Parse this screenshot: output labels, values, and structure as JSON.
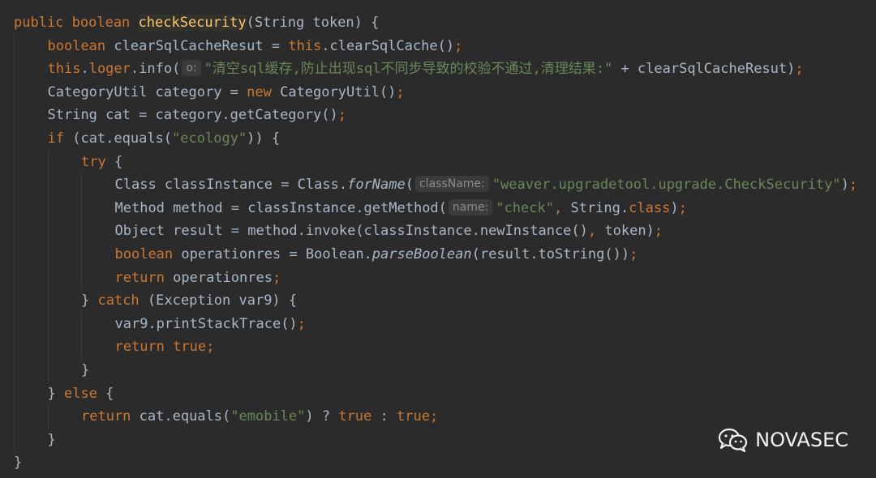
{
  "code": {
    "l1": {
      "t1": "public boolean ",
      "t2": "checkSecurity",
      "t3": "(String token) {"
    },
    "l2": {
      "t1": "boolean ",
      "t2": "clearSqlCacheResut = ",
      "t3": "this",
      "t4": ".clearSqlCache()",
      "t5": ";"
    },
    "l3": {
      "t1": "this",
      "t2": ".",
      "t3": "loger",
      "t4": ".info(",
      "hint": "o:",
      "t5": "\"清空sql缓存,防止出现sql不同步导致的校验不通过,清理结果:\"",
      "t6": " + clearSqlCacheResut)",
      "t7": ";"
    },
    "l4": {
      "t1": "CategoryUtil category = ",
      "t2": "new ",
      "t3": "CategoryUtil()",
      "t4": ";"
    },
    "l5": {
      "t1": "String cat = category.getCategory()",
      "t2": ";"
    },
    "l6": {
      "t1": "if ",
      "t2": "(cat.equals(",
      "t3": "\"ecology\"",
      "t4": ")) {"
    },
    "l7": {
      "t1": "try ",
      "t2": "{"
    },
    "l8": {
      "t1": "Class classInstance = Class.",
      "t2": "forName",
      "t3": "(",
      "hint": "className:",
      "t4": "\"weaver.upgradetool.upgrade.CheckSecurity\"",
      "t5": ")",
      "t6": ";"
    },
    "l9": {
      "t1": "Method method = classInstance.getMethod(",
      "hint": "name:",
      "t2": "\"check\"",
      "t3": ", ",
      "t4": "String.",
      "t5": "class",
      "t6": ")",
      "t7": ";"
    },
    "l10": {
      "t1": "Object result = method.invoke(classInstance.newInstance()",
      "t2": ", ",
      "t3": "token)",
      "t4": ";"
    },
    "l11": {
      "t1": "boolean ",
      "t2": "operationres = Boolean.",
      "t3": "parseBoolean",
      "t4": "(result.toString())",
      "t5": ";"
    },
    "l12": {
      "t1": "return ",
      "t2": "operationres",
      "t3": ";"
    },
    "l13": {
      "t1": "} ",
      "t2": "catch ",
      "t3": "(Exception var9) {"
    },
    "l14": {
      "t1": "var9.printStackTrace()",
      "t2": ";"
    },
    "l15": {
      "t1": "return ",
      "t2": "true",
      "t3": ";"
    },
    "l16": {
      "t1": "}"
    },
    "l17": {
      "t1": "} ",
      "t2": "else ",
      "t3": "{"
    },
    "l18": {
      "t1": "return ",
      "t2": "cat.equals(",
      "t3": "\"emobile\"",
      "t4": ") ? ",
      "t5": "true ",
      "t6": ": ",
      "t7": "true",
      "t8": ";"
    },
    "l19": {
      "t1": "}"
    },
    "l20": {
      "t1": "}"
    }
  },
  "watermark": {
    "text": "NOVASEC",
    "icon": "wechat-icon"
  },
  "colors": {
    "background": "#2b2b2b",
    "keyword": "#cc7832",
    "method_decl": "#ffc66d",
    "string": "#6a8759",
    "text": "#a9b7c6",
    "hint_bg": "#3b3b3b",
    "hint_text": "#8c8c8c"
  }
}
